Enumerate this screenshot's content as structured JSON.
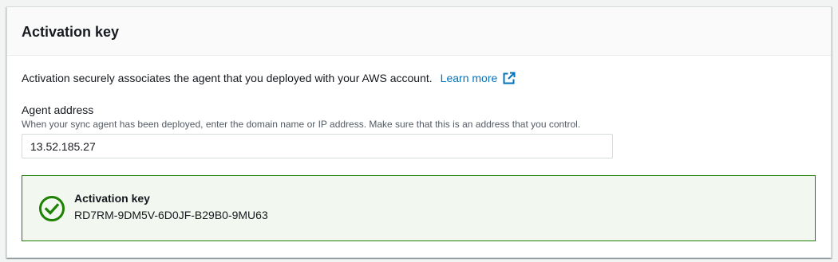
{
  "panel": {
    "title": "Activation key"
  },
  "description": {
    "text": "Activation securely associates the agent that you deployed with your AWS account.",
    "link_label": "Learn more",
    "link_icon": "external-link-icon"
  },
  "agent_address": {
    "label": "Agent address",
    "hint": "When your sync agent has been deployed, enter the domain name or IP address. Make sure that this is an address that you control.",
    "value": "13.52.185.27"
  },
  "alert": {
    "icon": "check-circle-icon",
    "title": "Activation key",
    "value": "RD7RM-9DM5V-6D0JF-B29B0-9MU63",
    "status": "success"
  },
  "colors": {
    "link": "#0073bb",
    "success": "#1d8102",
    "success_bg": "#f2f8f0"
  }
}
